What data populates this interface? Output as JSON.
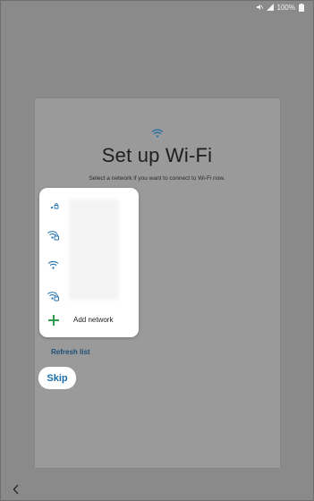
{
  "status_bar": {
    "battery_text": "100%",
    "icons": [
      "mute-icon",
      "signal-icon",
      "battery-icon"
    ]
  },
  "setup": {
    "title": "Set up Wi-Fi",
    "subtitle": "Select a network if you want to connect to Wi-Fi now.",
    "header_icon": "wifi-icon"
  },
  "network_popup": {
    "networks": [
      {
        "icon": "wifi-locked-icon",
        "signal": "low"
      },
      {
        "icon": "wifi-locked-icon",
        "signal": "full"
      },
      {
        "icon": "wifi-icon",
        "signal": "full"
      },
      {
        "icon": "wifi-locked-icon",
        "signal": "full"
      }
    ],
    "add_network_label": "Add network",
    "add_network_icon": "plus-icon"
  },
  "actions": {
    "refresh_label": "Refresh list",
    "skip_label": "Skip",
    "back_icon": "chevron-left-icon"
  },
  "colors": {
    "accent_blue": "#1d6ea8",
    "link_blue": "#1c4f78",
    "add_green": "#2f9a4c",
    "dim_background": "#8a8a8a"
  }
}
